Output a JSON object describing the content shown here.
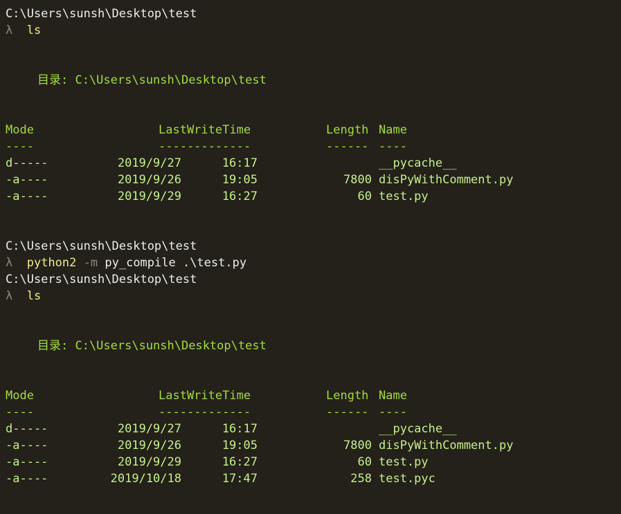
{
  "prompt_path": "C:\\Users\\sunsh\\Desktop\\test",
  "prompt_symbol": "λ",
  "cmd1": "ls",
  "dir_label": "目录: C:\\Users\\sunsh\\Desktop\\test",
  "headers": {
    "mode": "Mode",
    "lastwritetime": "LastWriteTime",
    "length": "Length",
    "name": "Name"
  },
  "underline": {
    "mode": "----",
    "lastwritetime": "-------------",
    "length": "------",
    "name": "----"
  },
  "listing1": [
    {
      "mode": "d-----",
      "date": "2019/9/27",
      "time": "16:17",
      "length": "",
      "name": "__pycache__"
    },
    {
      "mode": "-a----",
      "date": "2019/9/26",
      "time": "19:05",
      "length": "7800",
      "name": "disPyWithComment.py"
    },
    {
      "mode": "-a----",
      "date": "2019/9/29",
      "time": "16:27",
      "length": "60",
      "name": "test.py"
    }
  ],
  "cmd2": {
    "program": "python2",
    "flag": "-m",
    "args": "py_compile .\\test.py"
  },
  "cmd3": "ls",
  "listing2": [
    {
      "mode": "d-----",
      "date": "2019/9/27",
      "time": "16:17",
      "length": "",
      "name": "__pycache__"
    },
    {
      "mode": "-a----",
      "date": "2019/9/26",
      "time": "19:05",
      "length": "7800",
      "name": "disPyWithComment.py"
    },
    {
      "mode": "-a----",
      "date": "2019/9/29",
      "time": "16:27",
      "length": "60",
      "name": "test.py"
    },
    {
      "mode": "-a----",
      "date": "2019/10/18",
      "time": "17:47",
      "length": "258",
      "name": "test.pyc"
    }
  ]
}
